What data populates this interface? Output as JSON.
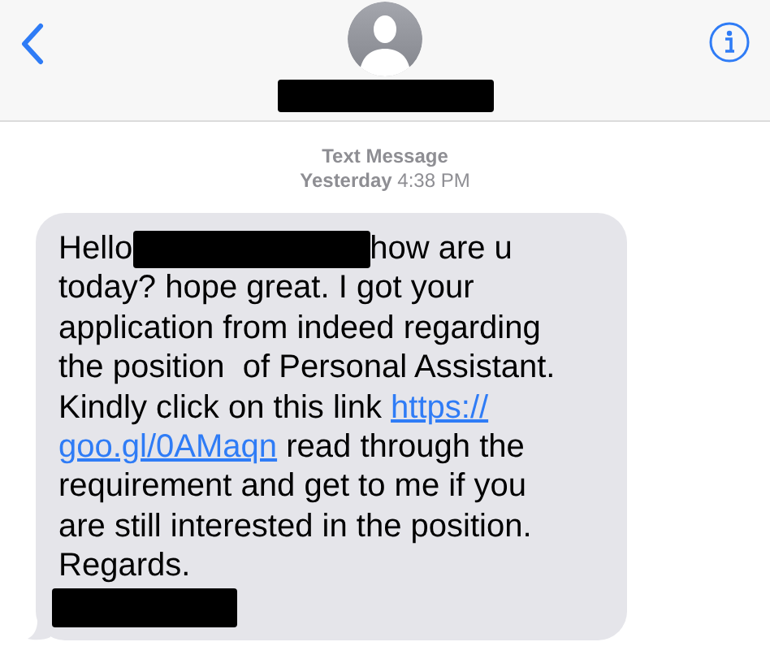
{
  "header": {
    "contact_name": {
      "kind": "redaction"
    }
  },
  "timestamp": {
    "label": "Text Message",
    "time": "**Yesterday** 4:38 PM"
  },
  "message": {
    "segments": [
      {
        "kind": "text",
        "text": "Hello"
      },
      {
        "kind": "redaction"
      },
      {
        "kind": "text",
        "text": "how are u\ntoday? hope great. I got your\napplication from indeed regarding\nthe position  of Personal Assistant.\nKindly click on this link "
      },
      {
        "kind": "link",
        "text": "https://"
      },
      {
        "kind": "line_break"
      },
      {
        "kind": "link",
        "text": "goo.gl/0AMaqn"
      },
      {
        "kind": "text",
        "text": " read through the\nrequirement and get to me if you\nare still interested in the position.\nRegards.\n"
      },
      {
        "kind": "redaction"
      }
    ]
  }
}
